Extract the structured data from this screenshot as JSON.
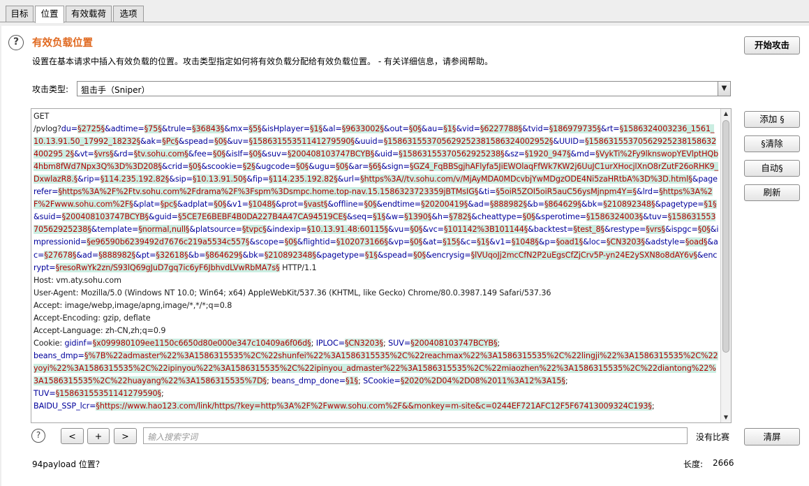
{
  "tabs": [
    {
      "label": "目标"
    },
    {
      "label": "位置"
    },
    {
      "label": "有效载荷"
    },
    {
      "label": "选项"
    }
  ],
  "section": {
    "title": "有效负载位置",
    "description": "设置在基本请求中插入有效负载的位置。攻击类型指定如何将有效负载分配给有效负载位置。 - 有关详细信息，请参阅帮助。"
  },
  "start_attack_button": "开始攻击",
  "attack_type": {
    "label": "攻击类型:",
    "selected": "狙击手（Sniper）"
  },
  "side_buttons": {
    "add": "添加 §",
    "clear": "§清除",
    "auto": "自动§",
    "refresh": "刷新"
  },
  "request_segments": [
    [
      "h",
      "GET\n/pvlog?"
    ],
    [
      "n",
      "du="
    ],
    [
      "p",
      "§2725§"
    ],
    [
      "n",
      "&adtime="
    ],
    [
      "p",
      "§75§"
    ],
    [
      "n",
      "&trule="
    ],
    [
      "p",
      "§36843§"
    ],
    [
      "n",
      "&mx="
    ],
    [
      "p",
      "§5§"
    ],
    [
      "n",
      "&isHplayer="
    ],
    [
      "p",
      "§1§"
    ],
    [
      "n",
      "&al="
    ],
    [
      "p",
      "§9633002§"
    ],
    [
      "n",
      "&out="
    ],
    [
      "p",
      "§0§"
    ],
    [
      "n",
      "&au="
    ],
    [
      "p",
      "§1§"
    ],
    [
      "n",
      "&vid="
    ],
    [
      "p",
      "§6227788§"
    ],
    [
      "n",
      "&tvid="
    ],
    [
      "p",
      "§186979735§"
    ],
    [
      "n",
      "&rt="
    ],
    [
      "p",
      "§1586324003236_1561_10.13.91.50_17992_18232§"
    ],
    [
      "n",
      "&ak="
    ],
    [
      "p",
      "§Pc§"
    ],
    [
      "n",
      "&spead="
    ],
    [
      "p",
      "§0§"
    ],
    [
      "n",
      "&uv="
    ],
    [
      "p",
      "§15863155351141279590§"
    ],
    [
      "n",
      "&uuid="
    ],
    [
      "p",
      "§158631553705629252381586324002952§"
    ],
    [
      "n",
      "&UUID="
    ],
    [
      "p",
      "§15863155370562925238158632400295 2§"
    ],
    [
      "n",
      "&vt="
    ],
    [
      "p",
      "§vrs§"
    ],
    [
      "n",
      "&rd="
    ],
    [
      "p",
      "§tv.sohu.com§"
    ],
    [
      "n",
      "&fee="
    ],
    [
      "p",
      "§0§"
    ],
    [
      "n",
      "&isIf="
    ],
    [
      "p",
      "§0§"
    ],
    [
      "n",
      "&suv="
    ],
    [
      "p",
      "§200408103747BCYB§"
    ],
    [
      "n",
      "&uid="
    ],
    [
      "p",
      "§15863155370562925238§"
    ],
    [
      "n",
      "&sz="
    ],
    [
      "p",
      "§1920_947§"
    ],
    [
      "n",
      "&md="
    ],
    [
      "p",
      "§VykTi%2Fy9lknswopYEVlptHQb4hbm8fWd7Npx3Q%3D%3D208§"
    ],
    [
      "n",
      "&crid="
    ],
    [
      "p",
      "§0§"
    ],
    [
      "n",
      "&scookie="
    ],
    [
      "p",
      "§2§"
    ],
    [
      "n",
      "&ugcode="
    ],
    [
      "p",
      "§0§"
    ],
    [
      "n",
      "&ugu="
    ],
    [
      "p",
      "§0§"
    ],
    [
      "n",
      "&ar="
    ],
    [
      "p",
      "§6§"
    ],
    [
      "n",
      "&sign="
    ],
    [
      "p",
      "§GZ4_FqBBSgjhAFlyfa5JiEWOlaqFfWk7KW2j6UuJC1urXHocjlXnO8rZutF26oRHK9_DxwlazR8.§"
    ],
    [
      "n",
      "&rip="
    ],
    [
      "p",
      "§114.235.192.82§"
    ],
    [
      "n",
      "&sip="
    ],
    [
      "p",
      "§10.13.91.50§"
    ],
    [
      "n",
      "&fip="
    ],
    [
      "p",
      "§114.235.192.82§"
    ],
    [
      "n",
      "&url="
    ],
    [
      "p",
      "§https%3A//tv.sohu.com/v/MjAyMDA0MDcvbjYwMDgzODE4Ni5zaHRtbA%3D%3D.html§"
    ],
    [
      "n",
      "&pagerefer="
    ],
    [
      "p",
      "§https%3A%2F%2Ftv.sohu.com%2Fdrama%2F%3Fspm%3Dsmpc.home.top-nav.15.1586323723359jBTMsIG§"
    ],
    [
      "n",
      "&ti="
    ],
    [
      "p",
      "§5oiR5ZOI5oiR5auC56ysMjnpm4Y=§"
    ],
    [
      "n",
      "&lrd="
    ],
    [
      "p",
      "§https%3A%2F%2Fwww.sohu.com%2F§"
    ],
    [
      "n",
      "&plat="
    ],
    [
      "p",
      "§pc§"
    ],
    [
      "n",
      "&adplat="
    ],
    [
      "p",
      "§0§"
    ],
    [
      "n",
      "&v1="
    ],
    [
      "p",
      "§1048§"
    ],
    [
      "n",
      "&prot="
    ],
    [
      "p",
      "§vast§"
    ],
    [
      "n",
      "&offline="
    ],
    [
      "p",
      "§0§"
    ],
    [
      "n",
      "&endtime="
    ],
    [
      "p",
      "§20200419§"
    ],
    [
      "n",
      "&ad="
    ],
    [
      "p",
      "§888982§"
    ],
    [
      "n",
      "&b="
    ],
    [
      "p",
      "§864629§"
    ],
    [
      "n",
      "&bk="
    ],
    [
      "p",
      "§210892348§"
    ],
    [
      "n",
      "&pagetype="
    ],
    [
      "p",
      "§1§"
    ],
    [
      "n",
      "&suid="
    ],
    [
      "p",
      "§200408103747BCYB§"
    ],
    [
      "n",
      "&guid="
    ],
    [
      "p",
      "§5CE7E6BEBF4B0DA227B4A47CA94519CE§"
    ],
    [
      "n",
      "&seq="
    ],
    [
      "p",
      "§1§"
    ],
    [
      "n",
      "&w="
    ],
    [
      "p",
      "§1390§"
    ],
    [
      "n",
      "&h="
    ],
    [
      "p",
      "§782§"
    ],
    [
      "n",
      "&cheattype="
    ],
    [
      "p",
      "§0§"
    ],
    [
      "n",
      "&sperotime="
    ],
    [
      "p",
      "§1586324003§"
    ],
    [
      "n",
      "&tuv="
    ],
    [
      "p",
      "§15863155370562925238§"
    ],
    [
      "n",
      "&template="
    ],
    [
      "p",
      "§normal,null§"
    ],
    [
      "n",
      "&platsource="
    ],
    [
      "p",
      "§tvpc§"
    ],
    [
      "n",
      "&indexip="
    ],
    [
      "p",
      "§10.13.91.48:60115§"
    ],
    [
      "n",
      "&vu="
    ],
    [
      "p",
      "§0§"
    ],
    [
      "n",
      "&vc="
    ],
    [
      "p",
      "§101142%3B101144§"
    ],
    [
      "n",
      "&backtest="
    ],
    [
      "p",
      "§test_8§"
    ],
    [
      "n",
      "&restype="
    ],
    [
      "p",
      "§vrs§"
    ],
    [
      "n",
      "&ispgc="
    ],
    [
      "p",
      "§0§"
    ],
    [
      "n",
      "&impressionid="
    ],
    [
      "p",
      "§e96590b6239492d7676c219a5534c557§"
    ],
    [
      "n",
      "&scope="
    ],
    [
      "p",
      "§0§"
    ],
    [
      "n",
      "&flightid="
    ],
    [
      "p",
      "§102073166§"
    ],
    [
      "n",
      "&vp="
    ],
    [
      "p",
      "§0§"
    ],
    [
      "n",
      "&at="
    ],
    [
      "p",
      "§15§"
    ],
    [
      "n",
      "&c="
    ],
    [
      "p",
      "§1§"
    ],
    [
      "n",
      "&v1="
    ],
    [
      "p",
      "§1048§"
    ],
    [
      "n",
      "&p="
    ],
    [
      "p",
      "§oad1§"
    ],
    [
      "n",
      "&loc="
    ],
    [
      "p",
      "§CN3203§"
    ],
    [
      "n",
      "&adstyle="
    ],
    [
      "p",
      "§oad§"
    ],
    [
      "n",
      "&ac="
    ],
    [
      "p",
      "§27678§"
    ],
    [
      "n",
      "&ad="
    ],
    [
      "p",
      "§888982§"
    ],
    [
      "n",
      "&pt="
    ],
    [
      "p",
      "§32618§"
    ],
    [
      "n",
      "&b="
    ],
    [
      "p",
      "§864629§"
    ],
    [
      "n",
      "&bk="
    ],
    [
      "p",
      "§210892348§"
    ],
    [
      "n",
      "&pagetype="
    ],
    [
      "p",
      "§1§"
    ],
    [
      "n",
      "&spead="
    ],
    [
      "p",
      "§0§"
    ],
    [
      "n",
      "&encrysig="
    ],
    [
      "p",
      "§lVUqoJj2mcCfN2P2uEgsCfZjCrv5P-yn24E2ySXN8o8dAY6v§"
    ],
    [
      "n",
      "&encrypt="
    ],
    [
      "p",
      "§resoRwYk2zn/S93lQ69gJuD7gq7ic6yF6JbhvdLVwRbMA7s§"
    ],
    [
      "h",
      " HTTP/1.1\nHost: vm.aty.sohu.com\nUser-Agent: Mozilla/5.0 (Windows NT 10.0; Win64; x64) AppleWebKit/537.36 (KHTML, like Gecko) Chrome/80.0.3987.149 Safari/537.36\nAccept: image/webp,image/apng,image/*,*/*;q=0.8\nAccept-Encoding: gzip, deflate\nAccept-Language: zh-CN,zh;q=0.9\nCookie: "
    ],
    [
      "n",
      "gidinf="
    ],
    [
      "p",
      "§x099980109ee1150c6650d80e000e347c10409a6f06d§"
    ],
    [
      "h",
      "; "
    ],
    [
      "n",
      "IPLOC="
    ],
    [
      "p",
      "§CN3203§"
    ],
    [
      "h",
      "; "
    ],
    [
      "n",
      "SUV="
    ],
    [
      "p",
      "§200408103747BCYB§"
    ],
    [
      "h",
      ";\n"
    ],
    [
      "n",
      "beans_dmp="
    ],
    [
      "p",
      "§%7B%22admaster%22%3A1586315535%2C%22shunfei%22%3A1586315535%2C%22reachmax%22%3A1586315535%2C%22lingji%22%3A1586315535%2C%22yoyi%22%3A1586315535%2C%22ipinyou%22%3A1586315535%2C%22ipinyou_admaster%22%3A1586315535%2C%22miaozhen%22%3A1586315535%2C%22diantong%22%3A1586315535%2C%22huayang%22%3A1586315535%7D§"
    ],
    [
      "h",
      "; "
    ],
    [
      "n",
      "beans_dmp_done="
    ],
    [
      "p",
      "§1§"
    ],
    [
      "h",
      "; "
    ],
    [
      "n",
      "SCookie="
    ],
    [
      "p",
      "§2020%2D04%2D08%2011%3A12%3A15§"
    ],
    [
      "h",
      ";\n"
    ],
    [
      "n",
      "TUV="
    ],
    [
      "p",
      "§15863155351141279590§"
    ],
    [
      "h",
      ";\n"
    ],
    [
      "n",
      "BAIDU_SSP_lcr="
    ],
    [
      "p",
      "§https://www.hao123.com/link/https/?key=http%3A%2F%2Fwww.sohu.com%2F&&monkey=m-site&c=0244EF721AFC12F5F67413009324C193§"
    ],
    [
      "h",
      ";"
    ]
  ],
  "search": {
    "prev": "<",
    "add": "+",
    "next": ">",
    "placeholder": "输入搜索字词",
    "status": "没有比赛",
    "clear_button": "清屏"
  },
  "footer": {
    "positions": "94payload 位置？",
    "length_label": "长度:",
    "length_value": "2666"
  }
}
